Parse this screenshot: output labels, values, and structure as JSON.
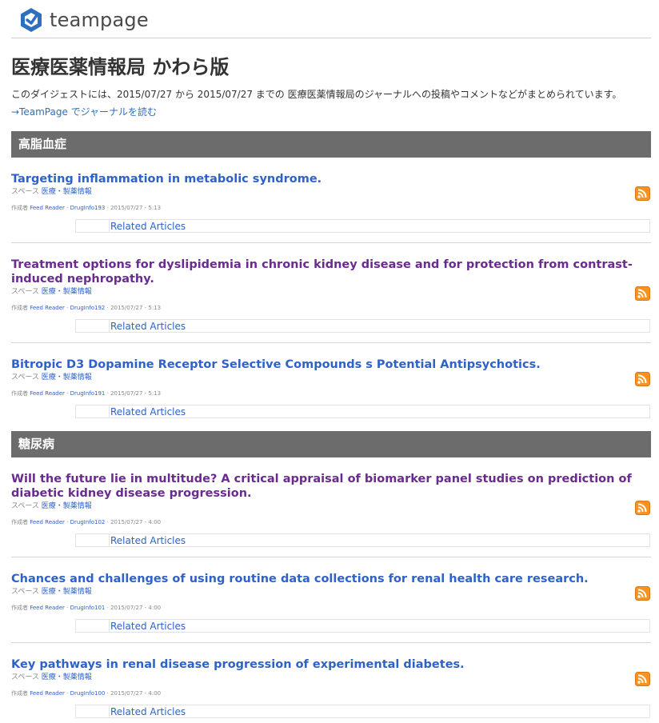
{
  "brand": {
    "logo_text": "teampage"
  },
  "page_title": "医療医薬情報局 かわら版",
  "intro": "このダイジェストには、2015/07/27 から 2015/07/27 までの 医療医薬情報局のジャーナルへの投稿やコメントなどがまとめられています。",
  "read_link": "→TeamPage でジャーナルを読む",
  "sections": [
    {
      "title": "高脂血症",
      "articles": [
        {
          "title": "Targeting inflammation in metabolic syndrome.",
          "space_label": "スペース",
          "space_name": "医療・製薬情報",
          "author_label": "作成者",
          "author": "Feed Reader",
          "id": "DrugInfo193",
          "timestamp": "2015/07/27 - 5:13",
          "related": "Related Articles"
        },
        {
          "title": "Treatment options for dyslipidemia in chronic kidney disease and for protection from contrast-induced nephropathy.",
          "space_label": "スペース",
          "space_name": "医療・製薬情報",
          "author_label": "作成者",
          "author": "Feed Reader",
          "id": "DrugInfo192",
          "timestamp": "2015/07/27 - 5:13",
          "related": "Related Articles"
        },
        {
          "title": "Bitropic D3 Dopamine Receptor Selective Compounds s Potential Antipsychotics.",
          "space_label": "スペース",
          "space_name": "医療・製薬情報",
          "author_label": "作成者",
          "author": "Feed Reader",
          "id": "DrugInfo191",
          "timestamp": "2015/07/27 - 5:13",
          "related": "Related Articles"
        }
      ]
    },
    {
      "title": "糖尿病",
      "articles": [
        {
          "title": "Will the future lie in multitude? A critical appraisal of biomarker panel studies on prediction of diabetic kidney disease progression.",
          "space_label": "スペース",
          "space_name": "医療・製薬情報",
          "author_label": "作成者",
          "author": "Feed Reader",
          "id": "DrugInfo102",
          "timestamp": "2015/07/27 - 4:00",
          "related": "Related Articles"
        },
        {
          "title": "Chances and challenges of using routine data collections for renal health care research.",
          "space_label": "スペース",
          "space_name": "医療・製薬情報",
          "author_label": "作成者",
          "author": "Feed Reader",
          "id": "DrugInfo101",
          "timestamp": "2015/07/27 - 4:00",
          "related": "Related Articles"
        },
        {
          "title": "Key pathways in renal disease progression of experimental diabetes.",
          "space_label": "スペース",
          "space_name": "医療・製薬情報",
          "author_label": "作成者",
          "author": "Feed Reader",
          "id": "DrugInfo100",
          "timestamp": "2015/07/27 - 4:00",
          "related": "Related Articles"
        }
      ]
    }
  ],
  "colors": {
    "link": "#2f62c8",
    "visited_link": "#6a2b8f",
    "section_header_bg": "#6c6c6c",
    "rss_orange": "#f7931e"
  },
  "icons": {
    "logo": "teampage-logo-icon",
    "rss": "rss-feed-icon"
  }
}
